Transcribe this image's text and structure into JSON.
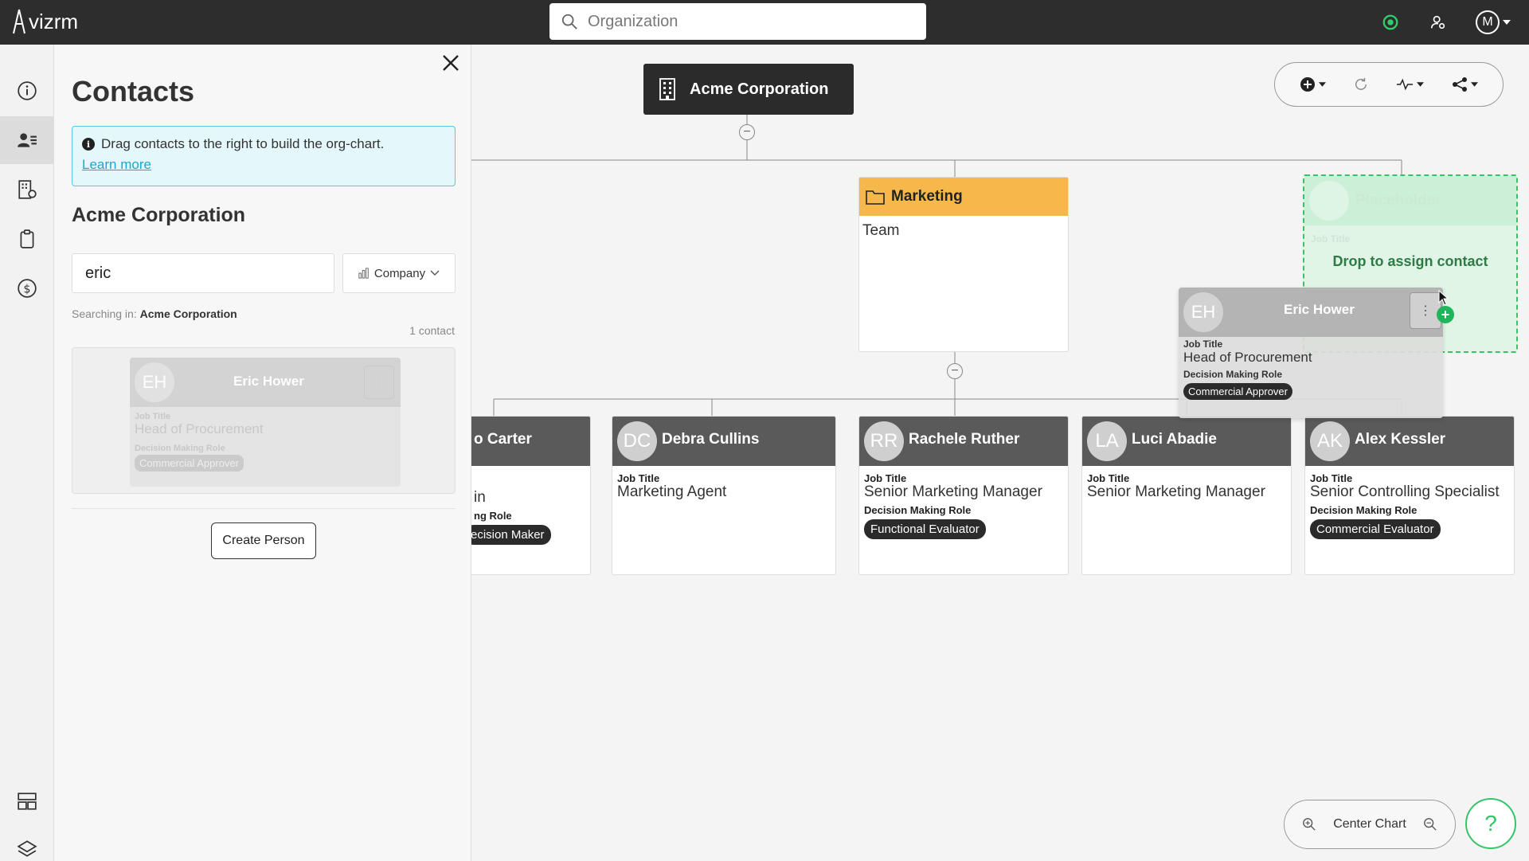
{
  "app": {
    "logo_text": "vizrm"
  },
  "topbar": {
    "search_placeholder": "Organization",
    "avatar_initial": "M",
    "icons": [
      "search-icon",
      "status-icon",
      "user-settings-icon",
      "avatar-menu"
    ]
  },
  "rail": {
    "items": [
      "info-icon",
      "contacts-icon",
      "organizations-icon",
      "clipboard-icon",
      "dollar-icon",
      "layout-icon",
      "layers-icon"
    ],
    "active": "contacts-icon"
  },
  "contacts_panel": {
    "title": "Contacts",
    "info_text": "Drag contacts to the right to build the org-chart.",
    "learn_more": "Learn more",
    "company_name": "Acme Corporation",
    "search_value": "eric",
    "filter_label": "Company",
    "searching_in_label": "Searching in:",
    "searching_in_value": "Acme Corporation",
    "count": "1 contact",
    "result_card": {
      "initials": "EH",
      "name": "Eric Hower",
      "job_title_label": "Job Title",
      "job_title": "Head of Procurement",
      "role_label": "Decision Making Role",
      "role": "Commercial Approver"
    },
    "create_button": "Create Person"
  },
  "chart": {
    "root": "Acme Corporation",
    "team": {
      "name": "Marketing",
      "type": "Team"
    },
    "placeholder": {
      "name": "Placeholder",
      "drop_text": "Drop to assign contact",
      "faint_label": "Job Title"
    },
    "dragging": {
      "initials": "EH",
      "name": "Eric Hower",
      "job_title_label": "Job Title",
      "job_title": "Head of Procurement",
      "role_label": "Decision Making Role",
      "role": "Commercial Approver"
    },
    "people": [
      {
        "initials": "",
        "name": "o Carter",
        "job_title_label": "",
        "job_title": "in",
        "role_label": "ng Role",
        "role": "ecision Maker"
      },
      {
        "initials": "DC",
        "name": "Debra Cullins",
        "job_title_label": "Job Title",
        "job_title": "Marketing Agent",
        "role_label": "",
        "role": ""
      },
      {
        "initials": "RR",
        "name": "Rachele Ruther",
        "job_title_label": "Job Title",
        "job_title": "Senior Marketing Manager",
        "role_label": "Decision Making Role",
        "role": "Functional Evaluator"
      },
      {
        "initials": "LA",
        "name": "Luci Abadie",
        "job_title_label": "Job Title",
        "job_title": "Senior Marketing Manager",
        "role_label": "",
        "role": ""
      },
      {
        "initials": "AK",
        "name": "Alex Kessler",
        "job_title_label": "Job Title",
        "job_title": "Senior Controlling Specialist",
        "role_label": "Decision Making Role",
        "role": "Commercial Evaluator"
      }
    ],
    "center_label": "Center Chart",
    "help_label": "?"
  },
  "colors": {
    "topbar": "#2d2d2d",
    "team_header": "#f7b84b",
    "placeholder_border": "#36c46b",
    "info_border": "#55c8e0",
    "link": "#1aa7d1"
  }
}
